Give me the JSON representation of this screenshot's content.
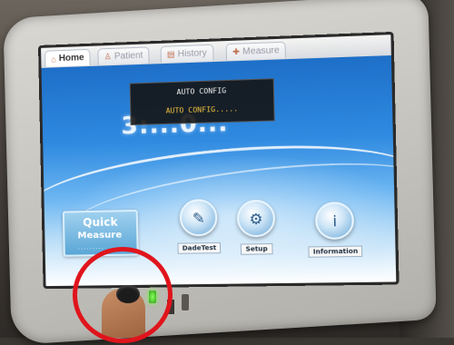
{
  "tabs": [
    {
      "label": "Home",
      "icon": "home-icon",
      "active": true
    },
    {
      "label": "Patient",
      "icon": "patient-icon",
      "active": false
    },
    {
      "label": "History",
      "icon": "history-icon",
      "active": false
    },
    {
      "label": "Measure",
      "icon": "measure-icon",
      "active": false
    }
  ],
  "dialog": {
    "title": "AUTO CONFIG",
    "status": "AUTO CONFIG....."
  },
  "main": {
    "big_number": "3:...0..."
  },
  "quick_measure": {
    "line1": "Quick",
    "line2": "Measure",
    "dots": "........."
  },
  "buttons": {
    "dadetest": "DadeTest",
    "setup": "Setup",
    "information": "Information"
  },
  "colors": {
    "accent": "#1e6fc8",
    "highlight_circle": "#e0141c",
    "led": "#6fff40"
  }
}
